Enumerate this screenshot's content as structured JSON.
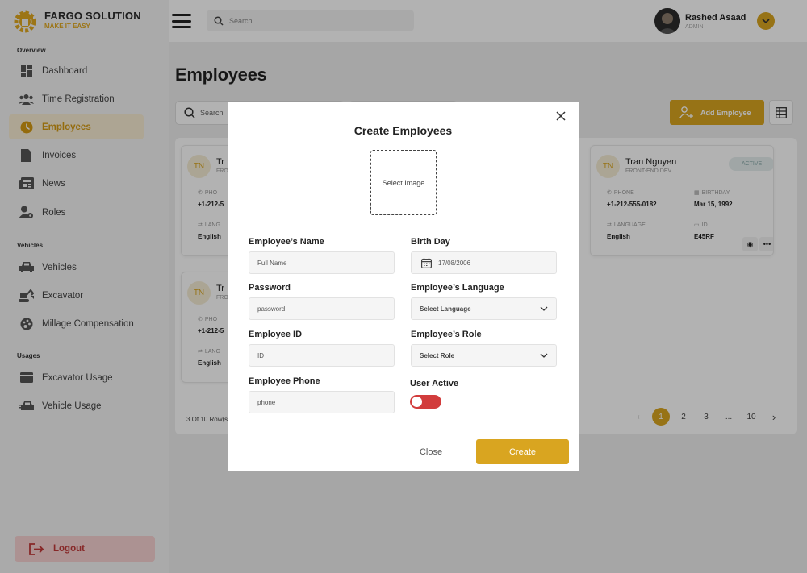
{
  "brand": {
    "name": "FARGO SOLUTION",
    "tagline": "MAKE IT EASY"
  },
  "sidebar": {
    "sections": [
      {
        "label": "Overview",
        "items": [
          {
            "label": "Dashboard",
            "icon": "dashboard-icon"
          },
          {
            "label": "Time Registration",
            "icon": "users-icon"
          },
          {
            "label": "Employees",
            "icon": "clock-icon",
            "active": true
          },
          {
            "label": "Invoices",
            "icon": "document-icon"
          },
          {
            "label": "News",
            "icon": "newspaper-icon"
          },
          {
            "label": "Roles",
            "icon": "user-gear-icon"
          }
        ]
      },
      {
        "label": "Vehicles",
        "items": [
          {
            "label": "Vehicles",
            "icon": "car-icon"
          },
          {
            "label": "Excavator",
            "icon": "excavator-icon"
          },
          {
            "label": "Millage Compensation",
            "icon": "palette-icon"
          }
        ]
      },
      {
        "label": "Usages",
        "items": [
          {
            "label": "Excavator Usage",
            "icon": "card-icon"
          },
          {
            "label": "Vehicle Usage",
            "icon": "car-speed-icon"
          }
        ]
      }
    ],
    "logout_label": "Logout"
  },
  "header": {
    "search_placeholder": "Search...",
    "user": {
      "name": "Rashed Asaad",
      "role": "ADMIN"
    }
  },
  "main": {
    "title": "Employees",
    "search_placeholder": "Search",
    "add_button_label": "Add Employee",
    "cards": [
      {
        "initials": "TN",
        "name": "Tr",
        "role": "FRO",
        "phone_label": "PHO",
        "phone": "+1-212-5",
        "language_label": "LANG",
        "language": "English"
      },
      {
        "initials": "TN",
        "name": "Tran Nguyen",
        "role": "FRONT-END DEV",
        "status": "ACTIVE",
        "phone_label": "PHONE",
        "phone": "+1-212-555-0182",
        "birthday_label": "BIRTHDAY",
        "birthday": "Mar 15, 1992",
        "language_label": "LANGUAGE",
        "language": "English",
        "id_label": "ID",
        "id": "E45RF"
      },
      {
        "initials": "TN",
        "name": "Tr",
        "role": "FRO",
        "phone_label": "PHO",
        "phone": "+1-212-5",
        "language_label": "LANG",
        "language": "English"
      }
    ],
    "rows_info": "3 Of 10 Row(s)",
    "pagination": {
      "pages": [
        "1",
        "2",
        "3",
        "...",
        "10"
      ],
      "active": "1"
    }
  },
  "modal": {
    "title": "Create Employees",
    "image_label": "Select Image",
    "fields": {
      "name": {
        "label": "Employee’s Name",
        "placeholder": "Full Name"
      },
      "birthday": {
        "label": "Birth Day",
        "value": "17/08/2006"
      },
      "password": {
        "label": "Password",
        "placeholder": "password"
      },
      "language": {
        "label": "Employee’s Language",
        "value": "Select Language"
      },
      "id": {
        "label": "Employee ID",
        "placeholder": "ID"
      },
      "role": {
        "label": "Employee’s Role",
        "value": "Select Role"
      },
      "phone": {
        "label": "Employee Phone",
        "placeholder": "phone"
      },
      "active": {
        "label": "User Active",
        "on": false
      }
    },
    "close_label": "Close",
    "create_label": "Create"
  },
  "colors": {
    "accent": "#d9a520",
    "danger": "#d23c3c",
    "active_bg": "#f8edd3"
  }
}
